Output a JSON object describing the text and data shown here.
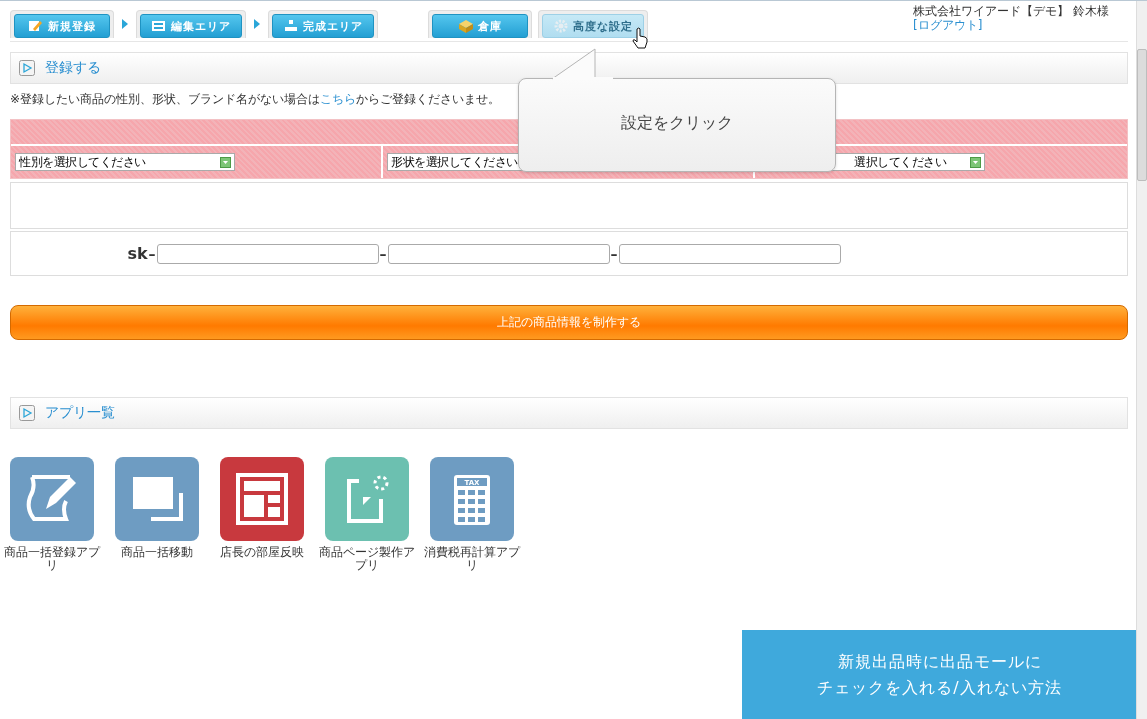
{
  "tabs": [
    {
      "label": "新規登録",
      "hovered": false
    },
    {
      "label": "編集エリア",
      "hovered": false
    },
    {
      "label": "完成エリア",
      "hovered": false
    },
    {
      "label": "倉庫",
      "hovered": false
    },
    {
      "label": "高度な設定",
      "hovered": true
    }
  ],
  "user": {
    "name": "株式会社ワイアード【デモ】 鈴木様",
    "logout": "[ログアウト]"
  },
  "register_section": {
    "title": "登録する",
    "note_before": "※登録したい商品の性別、形状、ブランド名がない場合は",
    "note_link": "こちら",
    "note_after": "からご登録くださいませ。",
    "selects": [
      "性別を選択してください",
      "形状を選択してください",
      "選択してください"
    ],
    "sku_prefix": "sk",
    "sku_separator": "–",
    "submit": "上記の商品情報を制作する"
  },
  "tooltip": "設定をクリック",
  "apps_section": {
    "title": "アプリ一覧",
    "apps": [
      {
        "label": "商品一括登録アプリ",
        "color": "#6e9cc2"
      },
      {
        "label": "商品一括移動",
        "color": "#6e9cc2"
      },
      {
        "label": "店長の部屋反映",
        "color": "#c8393e"
      },
      {
        "label": "商品ページ製作アプリ",
        "color": "#6cc0b0"
      },
      {
        "label": "消費税再計算アプリ",
        "color": "#6e9cc2",
        "icon_text": "TAX"
      }
    ]
  },
  "banner": {
    "lines": [
      "新規出品時に出品モールに",
      "チェックを入れる/入れない方法"
    ]
  }
}
